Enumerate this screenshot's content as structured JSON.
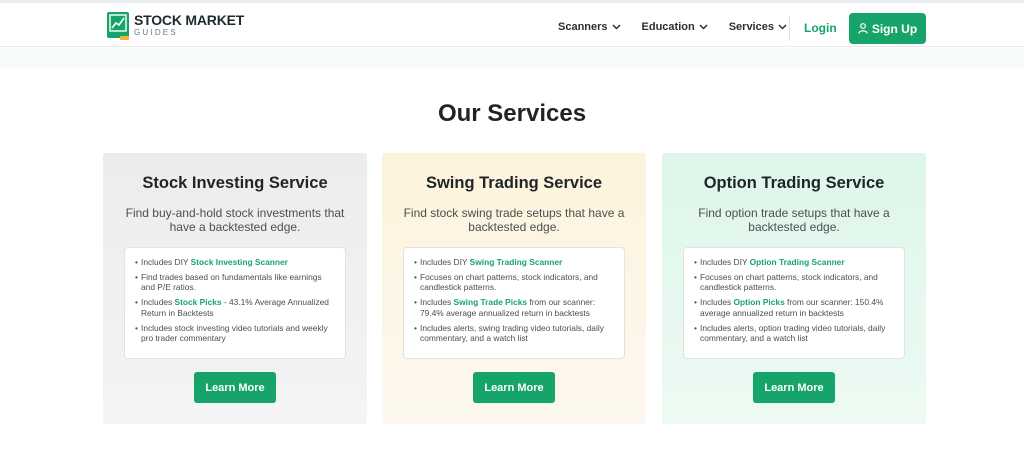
{
  "logo": {
    "line1": "STOCK MARKET",
    "line2": "GUIDES"
  },
  "nav": {
    "items": [
      "Scanners",
      "Education",
      "Services"
    ],
    "login": "Login",
    "signup": "Sign Up"
  },
  "section": {
    "title": "Our Services"
  },
  "colors": {
    "brand_green": "#16a46b",
    "logo_accent": "#f2b233"
  },
  "icons": {
    "nav_chevron": "chevron-down-icon",
    "signup": "user-icon",
    "logo": "chart-book-icon"
  },
  "cards": [
    {
      "title": "Stock Investing Service",
      "subtitle": "Find buy-and-hold stock investments that have a backtested edge.",
      "items": [
        {
          "pre": "Includes DIY ",
          "link": "Stock Investing Scanner",
          "post": ""
        },
        {
          "pre": "Find trades based on fundamentals like earnings and P/E ratios.",
          "link": "",
          "post": ""
        },
        {
          "pre": "Includes ",
          "link": "Stock Picks",
          "post": " - 43.1% Average Annualized Return in Backtests"
        },
        {
          "pre": "Includes stock investing video tutorials and weekly pro trader commentary",
          "link": "",
          "post": ""
        }
      ],
      "button": "Learn More"
    },
    {
      "title": "Swing Trading Service",
      "subtitle": "Find stock swing trade setups that have a backtested edge.",
      "items": [
        {
          "pre": "Includes DIY ",
          "link": "Swing Trading Scanner",
          "post": ""
        },
        {
          "pre": "Focuses on chart patterns, stock indicators, and candlestick patterns.",
          "link": "",
          "post": ""
        },
        {
          "pre": "Includes ",
          "link": "Swing Trade Picks",
          "post": " from our scanner: 79.4% average annualized return in backtests"
        },
        {
          "pre": "Includes alerts, swing trading video tutorials, daily commentary, and a watch list",
          "link": "",
          "post": ""
        }
      ],
      "button": "Learn More"
    },
    {
      "title": "Option Trading Service",
      "subtitle": "Find option trade setups that have a backtested edge.",
      "items": [
        {
          "pre": "Includes DIY ",
          "link": "Option Trading Scanner",
          "post": ""
        },
        {
          "pre": "Focuses on chart patterns, stock indicators, and candlestick patterns.",
          "link": "",
          "post": ""
        },
        {
          "pre": "Includes ",
          "link": "Option Picks",
          "post": " from our scanner: 150.4% average annualized return in backtests"
        },
        {
          "pre": "Includes alerts, option trading video tutorials, daily commentary, and a watch list",
          "link": "",
          "post": ""
        }
      ],
      "button": "Learn More"
    }
  ]
}
